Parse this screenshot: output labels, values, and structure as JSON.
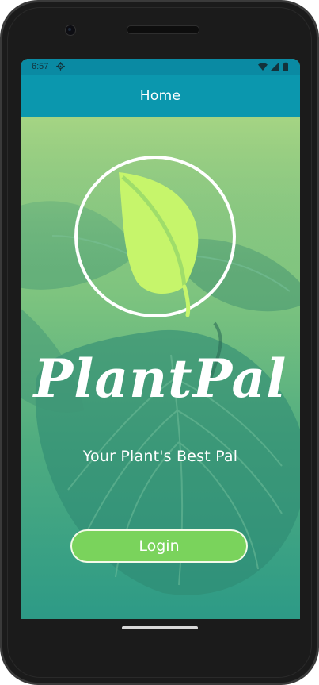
{
  "status_bar": {
    "time": "6:57",
    "icons": [
      "settings-gear-icon",
      "wifi-icon",
      "signal-icon",
      "battery-icon"
    ]
  },
  "app_bar": {
    "title": "Home"
  },
  "hero": {
    "brand_title": "PlantPal",
    "tagline": "Your Plant's Best Pal",
    "logo_icon": "leaf-icon"
  },
  "actions": {
    "login_label": "Login"
  },
  "colors": {
    "status_bar": "#0a8aa3",
    "app_bar": "#0b97ae",
    "leaf": "#c6f56b",
    "login_button": "#7ad35c"
  }
}
